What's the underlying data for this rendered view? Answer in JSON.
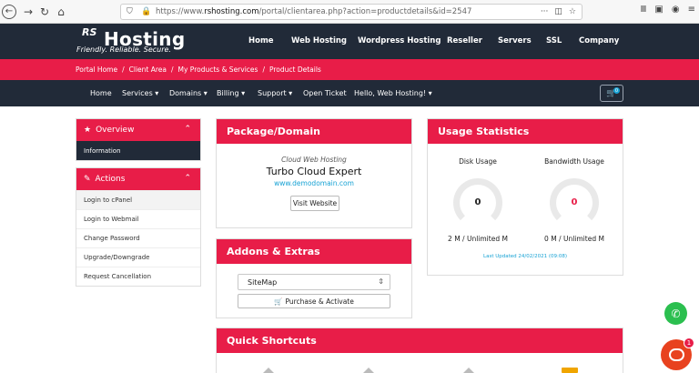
{
  "browser": {
    "url_prefix": "https://www.",
    "url_domain": "rshosting.com",
    "url_rest": "/portal/clientarea.php?action=productdetails&id=2547",
    "more_label": "···"
  },
  "header": {
    "logo_rs": "RS",
    "logo_hosting": "Hosting",
    "tagline": "Friendly. Reliable. Secure.",
    "nav": [
      "Home",
      "Web Hosting",
      "Wordpress Hosting",
      "Reseller",
      "Servers",
      "SSL",
      "Company"
    ]
  },
  "breadcrumb": [
    "Portal Home",
    "Client Area",
    "My Products & Services",
    "Product Details"
  ],
  "subnav": {
    "items": [
      "Home",
      "Services ▾",
      "Domains ▾",
      "Billing ▾",
      "Support ▾",
      "Open Ticket",
      "Hello, Web Hosting! ▾"
    ],
    "cart_count": "0"
  },
  "sidebar": {
    "overview": {
      "title": "Overview",
      "items": [
        "Information"
      ]
    },
    "actions": {
      "title": "Actions",
      "items": [
        "Login to cPanel",
        "Login to Webmail",
        "Change Password",
        "Upgrade/Downgrade",
        "Request Cancellation"
      ]
    }
  },
  "package": {
    "title": "Package/Domain",
    "group": "Cloud Web Hosting",
    "product": "Turbo Cloud Expert",
    "domain": "www.demodomain.com",
    "visit_label": "Visit Website"
  },
  "addons": {
    "title": "Addons & Extras",
    "selected": "SiteMap",
    "purchase_label": "Purchase & Activate"
  },
  "usage": {
    "title": "Usage Statistics",
    "disk_label": "Disk Usage",
    "bandwidth_label": "Bandwidth Usage",
    "disk_value": "0",
    "bandwidth_value": "0",
    "disk_text": "2 M / Unlimited M",
    "bandwidth_text": "0 M / Unlimited M",
    "last_updated": "Last Updated 24/02/2021 (09:08)"
  },
  "shortcuts": {
    "title": "Quick Shortcuts"
  },
  "chat": {
    "badge": "1"
  },
  "colors": {
    "brand_red": "#e81d48",
    "navy": "#212a38",
    "accent_blue": "#17a2d4"
  }
}
